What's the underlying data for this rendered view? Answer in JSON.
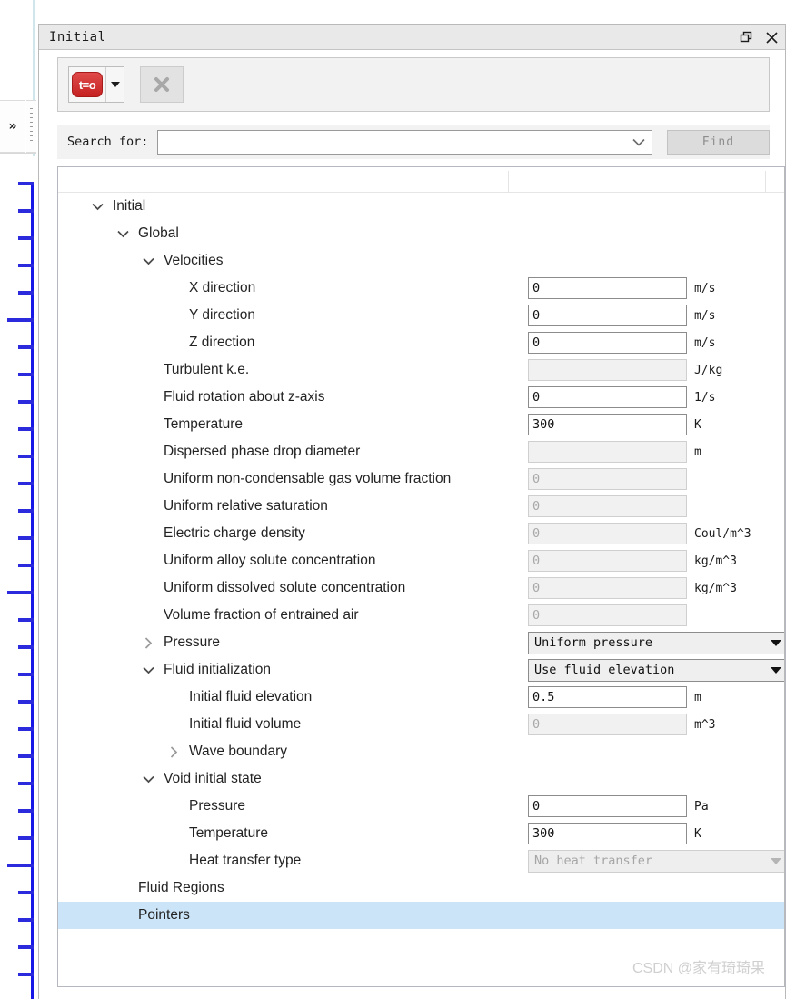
{
  "window": {
    "title": "Initial",
    "restore_icon": "restore-window-icon",
    "close_icon": "close-icon"
  },
  "left_rail": {
    "expand_label": "»",
    "grip": "drag-handle"
  },
  "toolbar": {
    "reset_button_label": "t=o",
    "dropdown_icon": "chevron-down-icon",
    "delete_button_icon": "close-x-icon"
  },
  "search": {
    "label": "Search for:",
    "value": "",
    "placeholder": "",
    "dropdown_icon": "chevron-down-icon",
    "find_label": "Find"
  },
  "tree": [
    {
      "indent": 0,
      "twisty": "expanded",
      "label": "Initial"
    },
    {
      "indent": 1,
      "twisty": "expanded",
      "label": "Global"
    },
    {
      "indent": 2,
      "twisty": "expanded",
      "label": "Velocities"
    },
    {
      "indent": 3,
      "twisty": "none",
      "label": "X direction",
      "field": {
        "value": "0",
        "enabled": true
      },
      "unit": "m/s"
    },
    {
      "indent": 3,
      "twisty": "none",
      "label": "Y direction",
      "field": {
        "value": "0",
        "enabled": true
      },
      "unit": "m/s"
    },
    {
      "indent": 3,
      "twisty": "none",
      "label": "Z direction",
      "field": {
        "value": "0",
        "enabled": true
      },
      "unit": "m/s"
    },
    {
      "indent": 2,
      "twisty": "none",
      "label": "Turbulent k.e.",
      "field": {
        "value": "",
        "enabled": false
      },
      "unit": "J/kg"
    },
    {
      "indent": 2,
      "twisty": "none",
      "label": "Fluid rotation about z-axis",
      "field": {
        "value": "0",
        "enabled": true
      },
      "unit": "1/s"
    },
    {
      "indent": 2,
      "twisty": "none",
      "label": "Temperature",
      "field": {
        "value": "300",
        "enabled": true
      },
      "unit": "K"
    },
    {
      "indent": 2,
      "twisty": "none",
      "label": "Dispersed phase drop diameter",
      "field": {
        "value": "",
        "enabled": false
      },
      "unit": "m"
    },
    {
      "indent": 2,
      "twisty": "none",
      "label": "Uniform non-condensable gas volume fraction",
      "field": {
        "value": "0",
        "enabled": false
      },
      "unit": ""
    },
    {
      "indent": 2,
      "twisty": "none",
      "label": "Uniform relative saturation",
      "field": {
        "value": "0",
        "enabled": false
      },
      "unit": ""
    },
    {
      "indent": 2,
      "twisty": "none",
      "label": "Electric charge density",
      "field": {
        "value": "0",
        "enabled": false
      },
      "unit": "Coul/m^3"
    },
    {
      "indent": 2,
      "twisty": "none",
      "label": "Uniform alloy solute concentration",
      "field": {
        "value": "0",
        "enabled": false
      },
      "unit": "kg/m^3"
    },
    {
      "indent": 2,
      "twisty": "none",
      "label": "Uniform dissolved solute concentration",
      "field": {
        "value": "0",
        "enabled": false
      },
      "unit": "kg/m^3"
    },
    {
      "indent": 2,
      "twisty": "none",
      "label": "Volume fraction of entrained air",
      "field": {
        "value": "0",
        "enabled": false
      },
      "unit": ""
    },
    {
      "indent": 2,
      "twisty": "collapsed",
      "label": "Pressure",
      "combo": {
        "value": "Uniform pressure",
        "enabled": true
      }
    },
    {
      "indent": 2,
      "twisty": "expanded",
      "label": "Fluid initialization",
      "combo": {
        "value": "Use fluid elevation",
        "enabled": true
      }
    },
    {
      "indent": 3,
      "twisty": "none",
      "label": "Initial fluid elevation",
      "field": {
        "value": "0.5",
        "enabled": true
      },
      "unit": "m"
    },
    {
      "indent": 3,
      "twisty": "none",
      "label": "Initial fluid volume",
      "field": {
        "value": "0",
        "enabled": false
      },
      "unit": "m^3"
    },
    {
      "indent": 3,
      "twisty": "collapsed",
      "label": "Wave boundary"
    },
    {
      "indent": 2,
      "twisty": "expanded",
      "label": "Void initial state"
    },
    {
      "indent": 3,
      "twisty": "none",
      "label": "Pressure",
      "field": {
        "value": "0",
        "enabled": true
      },
      "unit": "Pa"
    },
    {
      "indent": 3,
      "twisty": "none",
      "label": "Temperature",
      "field": {
        "value": "300",
        "enabled": true
      },
      "unit": "K"
    },
    {
      "indent": 3,
      "twisty": "none",
      "label": "Heat transfer type",
      "combo": {
        "value": "No heat transfer",
        "enabled": false
      }
    },
    {
      "indent": 1,
      "twisty": "none",
      "label": "Fluid Regions"
    },
    {
      "indent": 1,
      "twisty": "none",
      "label": "Pointers",
      "selected": true
    }
  ],
  "watermark": "CSDN @家有琦琦果",
  "colors": {
    "selection": "#cce4f7",
    "accent_red": "#c62222",
    "ruler_blue": "#1717e8",
    "titlebar": "#e9e9e9"
  }
}
